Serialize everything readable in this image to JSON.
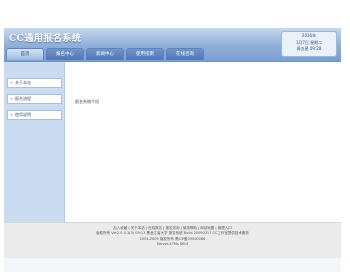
{
  "header": {
    "site_title": "CC通用报名系统",
    "info": [
      "2016年",
      "1月7日 星期二",
      "周五星 09:28"
    ]
  },
  "nav": {
    "items": [
      {
        "label": "首页",
        "active": true
      },
      {
        "label": "报名中心",
        "active": false
      },
      {
        "label": "新闻中心",
        "active": false
      },
      {
        "label": "使用指南",
        "active": false
      },
      {
        "label": "在线咨询",
        "active": false
      }
    ]
  },
  "sidebar": {
    "items": [
      {
        "label": "关于本站"
      },
      {
        "label": "报名流程"
      },
      {
        "label": "使用说明"
      }
    ]
  },
  "main": {
    "text": "报名系统介绍"
  },
  "footer": {
    "lines": [
      "加入收藏 | 关于本站 | 在线报名 | 报名查询 | 使用帮助 | 网站地图 | 管理入口",
      "版权所有 Ver2.0 4.1(3) 09:13 黑龙江省大学 报名系统 Build 20090317 CC工作室提供技术服务",
      "2004-2009 版权所有 黑ICP备09000066",
      "Server:47Ms  DB:4"
    ]
  }
}
